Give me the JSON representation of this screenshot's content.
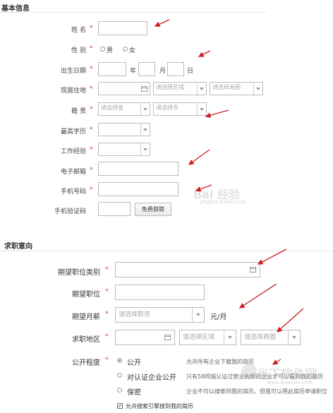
{
  "section1": {
    "title": "基本信息",
    "name_label": "姓  名",
    "gender_label": "性  别",
    "gender_male": "男",
    "gender_female": "女",
    "dob_label": "出生日期",
    "year": "年",
    "month": "月",
    "day": "日",
    "residence_label": "现居住地",
    "residence_area_ph": "请选择区域",
    "residence_zone_ph": "请选择商圈",
    "hometown_label": "籍  贯",
    "hometown_province_ph": "请选择省",
    "hometown_city_ph": "请选择市",
    "education_label": "最高学历",
    "experience_label": "工作经验",
    "email_label": "电子邮箱",
    "phone_label": "手机号码",
    "verify_label": "手机验证码",
    "verify_button": "免费获取",
    "required_mark": "*"
  },
  "section2": {
    "title": "求职意向",
    "category_label": "期望职位类别",
    "position_label": "期望职位",
    "salary_label": "期望月薪",
    "salary_ph": "请选择薪资",
    "salary_unit": "元/月",
    "region_label": "求职地区",
    "region_area_ph": "请选择区域",
    "region_zone_ph": "请选择商圈",
    "visibility_label": "公开程度",
    "options": [
      {
        "label": "公开",
        "desc": "允许所有企业下载我的简历",
        "selected": true
      },
      {
        "label": "对认证企业公开",
        "desc": "只有58同城认证过营业执照的企业才可以看到我的简历",
        "selected": false
      },
      {
        "label": "保密",
        "desc": "企业不可以搜索到我的简历，但我可以用此简历申请职位",
        "selected": false
      }
    ],
    "search_engine_checkbox": "允许搜索引擎搜到我的简历",
    "required_mark": "*"
  },
  "watermarks": {
    "baidu": "Bai 经验",
    "baidu_url": "jingyan.baidu.com",
    "site": "当下软件园",
    "site_url": "www.downxia.com"
  },
  "colors": {
    "arrow": "#cc1f1f",
    "required": "#dd3333"
  }
}
